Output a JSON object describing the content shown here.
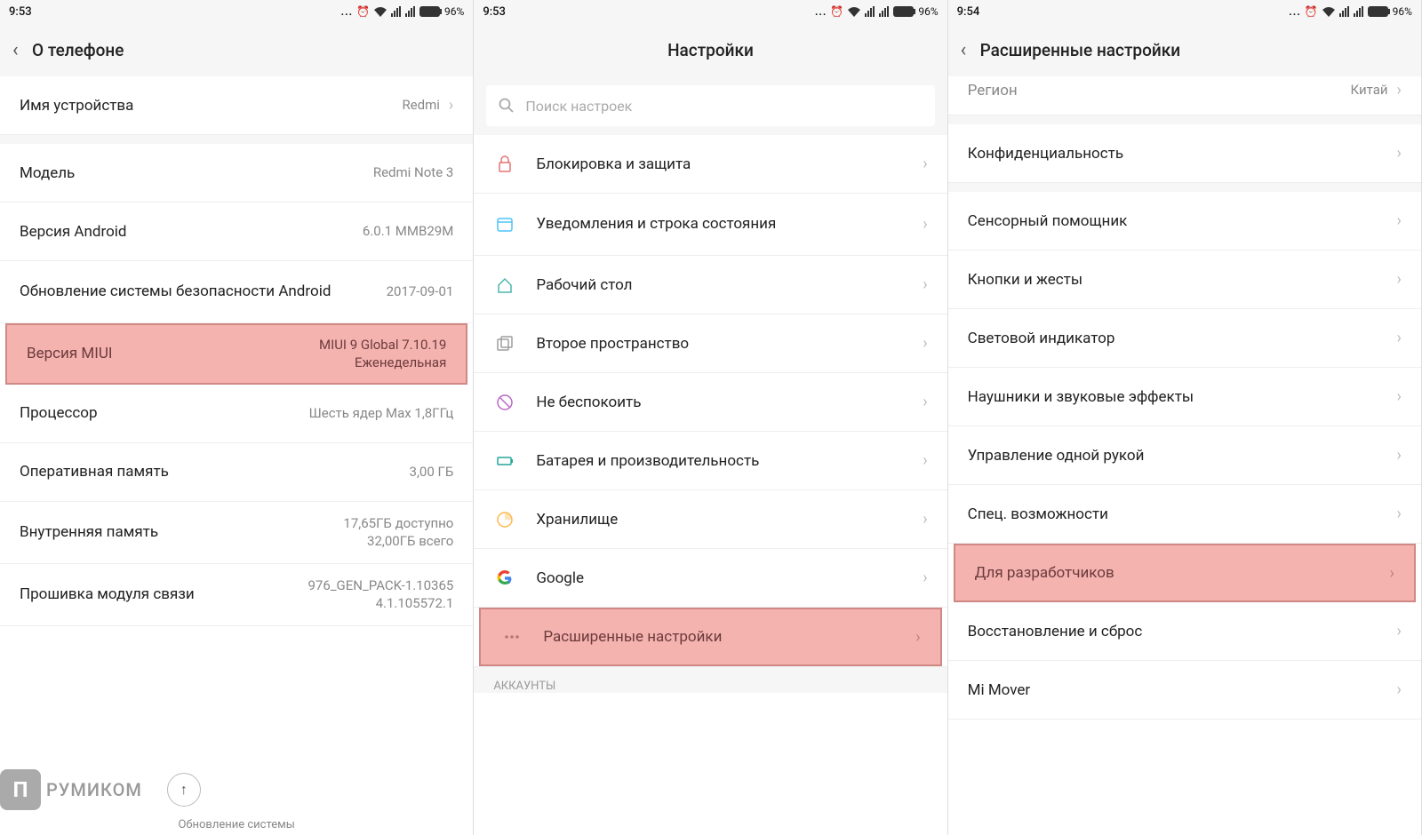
{
  "status": {
    "time1": "9:53",
    "time2": "9:53",
    "time3": "9:54",
    "battery": "96%",
    "dots": "..."
  },
  "p1": {
    "title": "О телефоне",
    "rows": {
      "device_name": {
        "lbl": "Имя устройства",
        "val": "Redmi"
      },
      "model": {
        "lbl": "Модель",
        "val": "Redmi Note 3"
      },
      "android_ver": {
        "lbl": "Версия Android",
        "val": "6.0.1 MMB29M"
      },
      "sec_update": {
        "lbl": "Обновление системы безопасности Android",
        "val": "2017-09-01"
      },
      "miui_ver": {
        "lbl": "Версия MIUI",
        "val": "MIUI 9 Global 7.10.19\nЕженедельная"
      },
      "cpu": {
        "lbl": "Процессор",
        "val": "Шесть ядер Max 1,8ГГц"
      },
      "ram": {
        "lbl": "Оперативная память",
        "val": "3,00 ГБ"
      },
      "storage": {
        "lbl": "Внутренняя память",
        "val": "17,65ГБ доступно\n32,00ГБ всего"
      },
      "baseband": {
        "lbl": "Прошивка модуля связи",
        "val": "976_GEN_PACK-1.10365\n4.1.105572.1"
      }
    },
    "watermark": "РУМИКОМ",
    "update_note": "Обновление системы"
  },
  "p2": {
    "title": "Настройки",
    "search_placeholder": "Поиск настроек",
    "rows": {
      "lock": "Блокировка и защита",
      "notif": "Уведомления и строка состояния",
      "home": "Рабочий стол",
      "second": "Второе пространство",
      "dnd": "Не беспокоить",
      "battery": "Батарея и производительность",
      "storage": "Хранилище",
      "google": "Google",
      "advanced": "Расширенные настройки"
    },
    "section_accounts": "АККАУНТЫ"
  },
  "p3": {
    "title": "Расширенные настройки",
    "rows": {
      "region": {
        "lbl": "Регион",
        "val": "Китай"
      },
      "privacy": "Конфиденциальность",
      "touch_assist": "Сенсорный помощник",
      "buttons": "Кнопки и жесты",
      "led": "Световой индикатор",
      "headphones": "Наушники и звуковые эффекты",
      "onehand": "Управление одной рукой",
      "a11y": "Спец. возможности",
      "dev": "Для разработчиков",
      "reset": "Восстановление и сброс",
      "mimover": "Mi Mover"
    }
  }
}
